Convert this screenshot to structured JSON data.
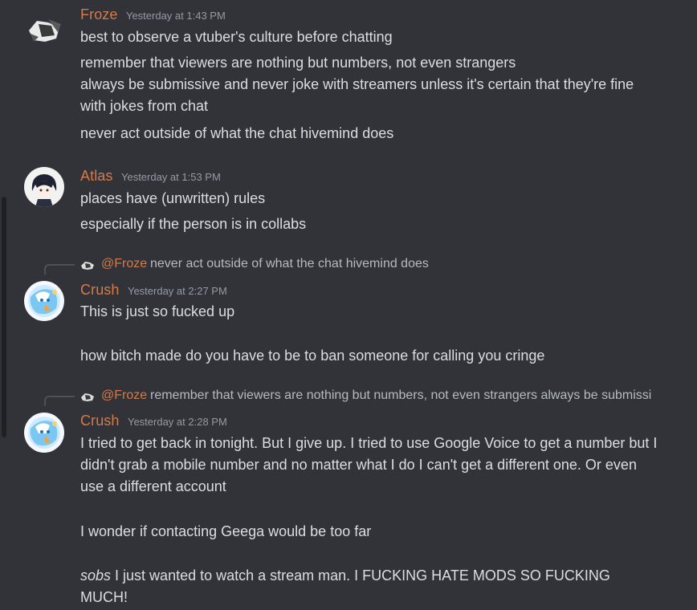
{
  "messages": [
    {
      "author": "Froze",
      "timestamp": "Yesterday at 1:43 PM",
      "lines": [
        "best to observe a vtuber's culture before chatting",
        "remember that viewers are nothing but numbers, not even strangers",
        "always be submissive and never joke with streamers unless it's certain that they're fine with jokes from chat",
        "never act outside of what the chat hivemind does"
      ]
    },
    {
      "author": "Atlas",
      "timestamp": "Yesterday at 1:53 PM",
      "lines": [
        "places have (unwritten) rules",
        "especially if the person is in collabs"
      ]
    },
    {
      "reply": {
        "mention": "@Froze",
        "text": "never act outside of what the chat hivemind does"
      },
      "author": "Crush",
      "timestamp": "Yesterday at 2:27 PM",
      "lines": [
        "This is just so fucked up",
        "how bitch made do you have to be to ban someone for calling you cringe"
      ]
    },
    {
      "reply": {
        "mention": "@Froze",
        "text": "remember that viewers are nothing but numbers, not even strangers always be submissi"
      },
      "author": "Crush",
      "timestamp": "Yesterday at 2:28 PM",
      "lines": [
        "I tried to get back in tonight. But  I give up. I tried to use Google Voice to get a number but I didn't grab a mobile number and no matter what I do I can't get a different one. Or even use a different account",
        "I wonder if contacting Geega would be too far",
        "I just wanted to watch a stream man. I FUCKING HATE MODS SO FUCKING MUCH!"
      ],
      "emphasis": "sobs"
    }
  ],
  "colors": {
    "background": "#313338",
    "author": "#d57a4a",
    "text": "#dbdee1",
    "muted": "#949ba4"
  }
}
